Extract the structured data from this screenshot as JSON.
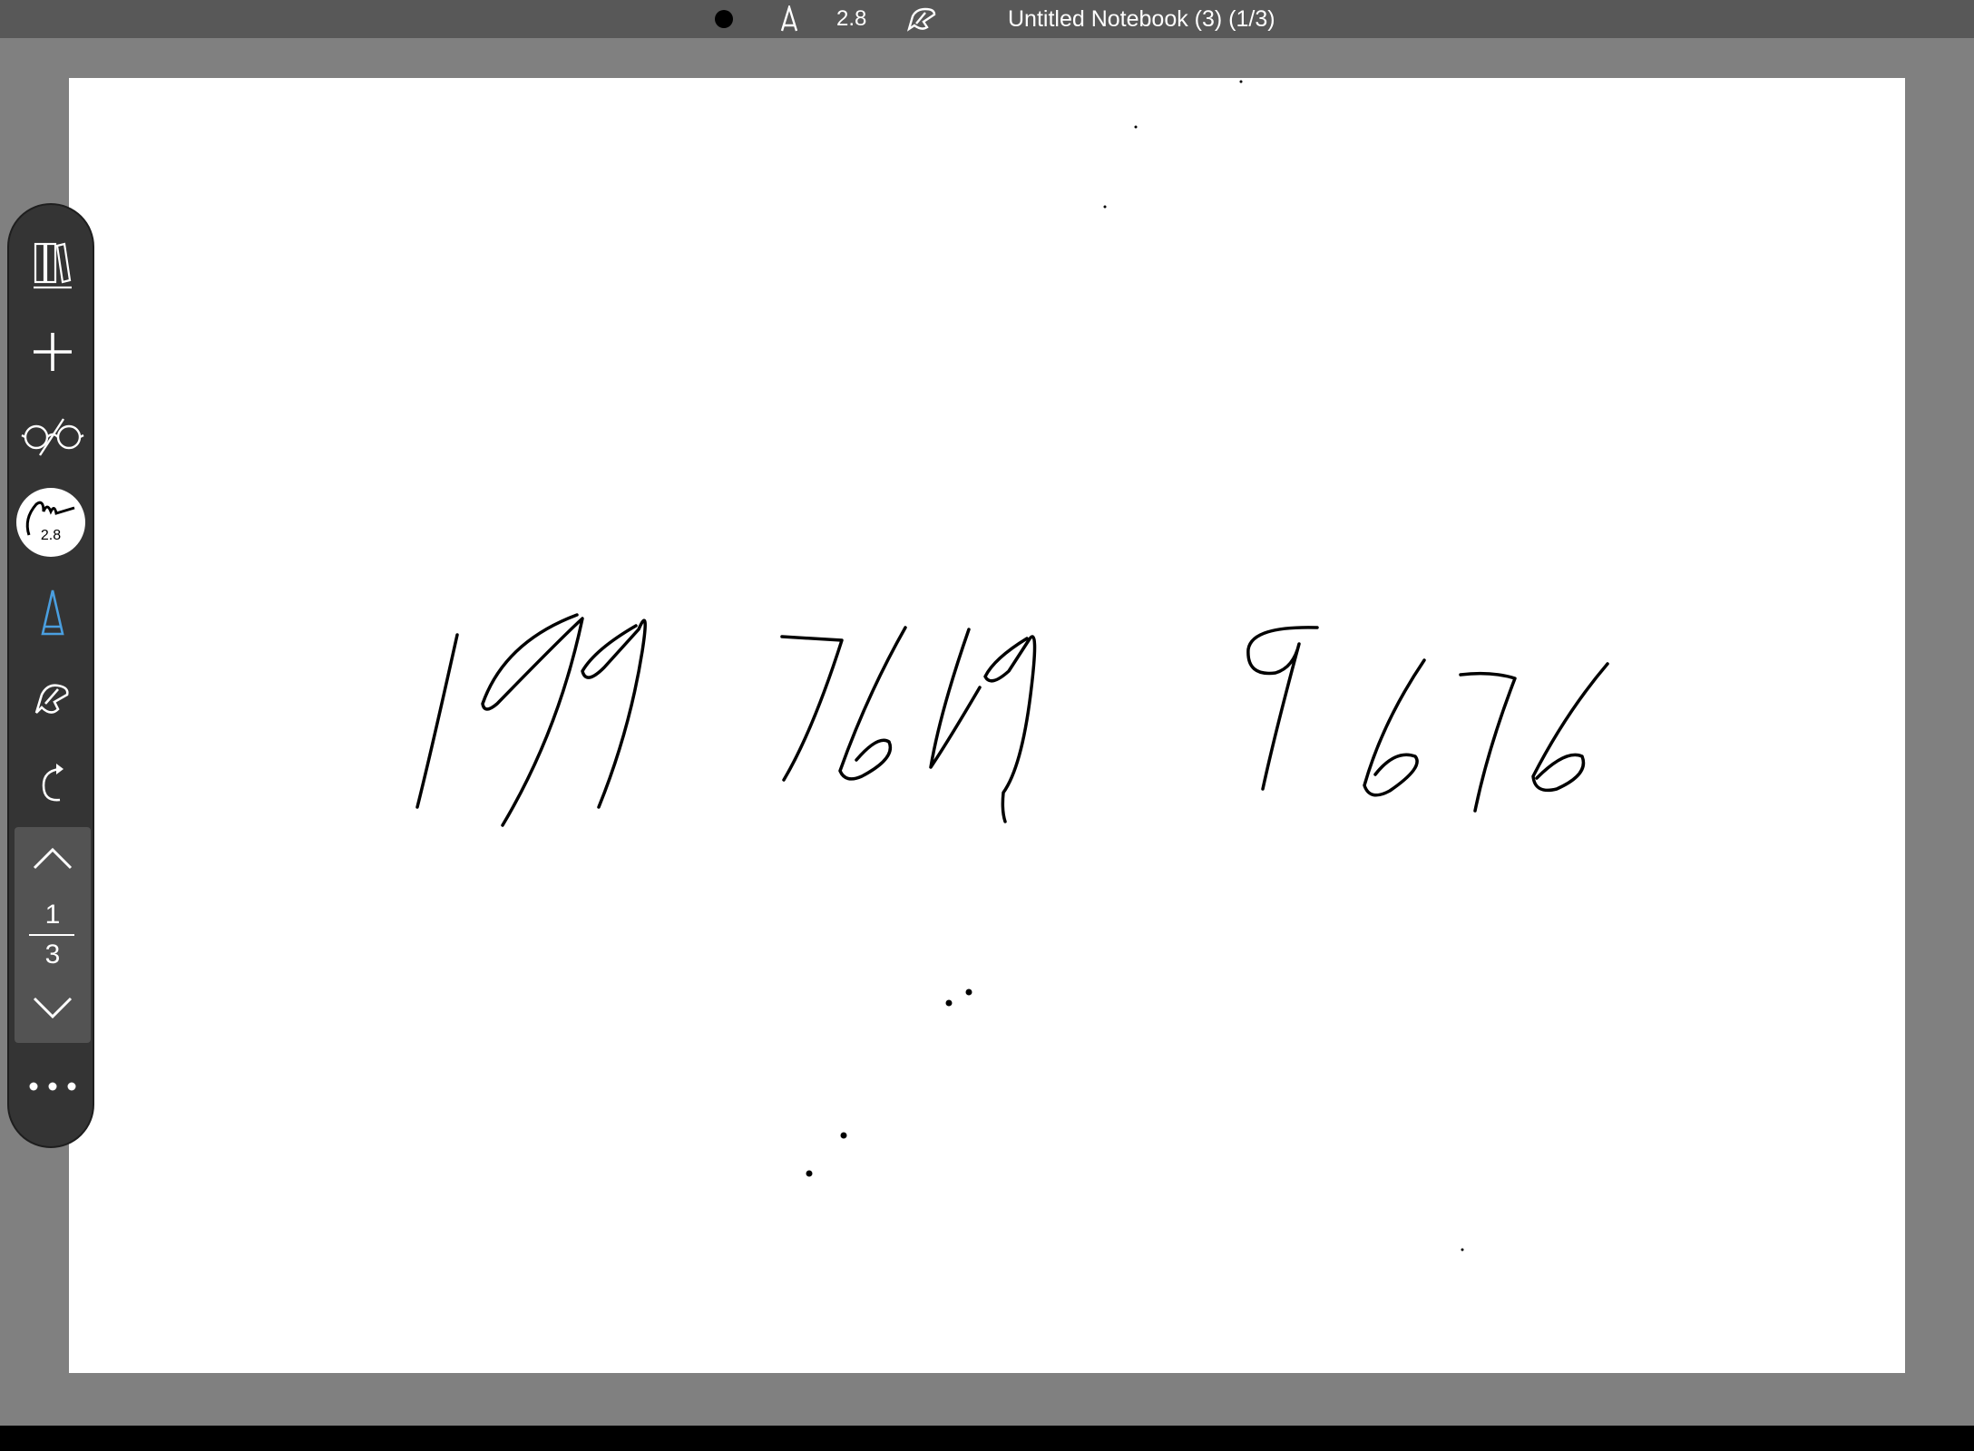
{
  "header": {
    "pen_size": "2.8",
    "notebook_title": "Untitled Notebook (3) (1/3)"
  },
  "toolbar": {
    "items": [
      {
        "icon": "library-icon"
      },
      {
        "icon": "plus-icon"
      },
      {
        "icon": "glasses-icon"
      },
      {
        "icon": "pen-style-icon",
        "label": "2.8"
      },
      {
        "icon": "pen-tip-icon",
        "color": "#4a9fe0"
      },
      {
        "icon": "eraser-hand-icon"
      },
      {
        "icon": "redo-icon"
      }
    ],
    "pager": {
      "current_page": "1",
      "total_pages": "3"
    },
    "more_icon": "more-icon"
  },
  "canvas": {
    "handwriting": "199 7619 9676"
  },
  "colors": {
    "topbar": "#585858",
    "toolbar": "#343434",
    "background": "#808080",
    "accent": "#4a9fe0"
  }
}
